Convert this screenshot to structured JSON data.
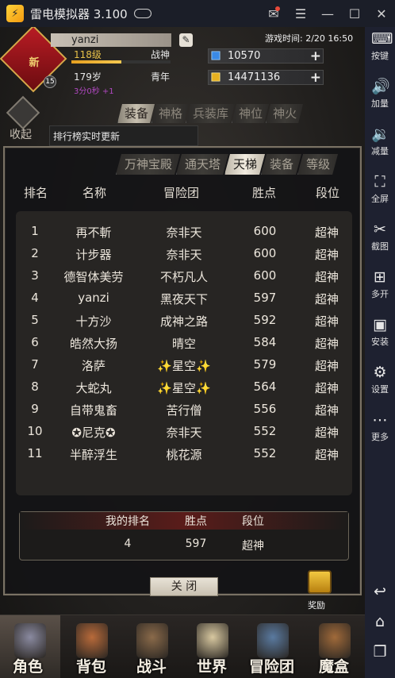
{
  "emulator": {
    "title": "雷电模拟器 3.100",
    "logo_glyph": "⚡",
    "controls": [
      "mail-icon",
      "menu-icon",
      "minimize-icon",
      "maximize-icon",
      "close-icon"
    ]
  },
  "sidebar": {
    "items": [
      {
        "label": "按键",
        "icon": "keyboard-icon",
        "glyph": "⌨"
      },
      {
        "label": "加量",
        "icon": "volume-up-icon",
        "glyph": "🔊"
      },
      {
        "label": "减量",
        "icon": "volume-down-icon",
        "glyph": "🔉"
      },
      {
        "label": "全屏",
        "icon": "fullscreen-icon",
        "glyph": "⛶"
      },
      {
        "label": "截图",
        "icon": "scissors-icon",
        "glyph": "✂"
      },
      {
        "label": "多开",
        "icon": "multi-open-icon",
        "glyph": "⊞"
      },
      {
        "label": "安装",
        "icon": "apk-install-icon",
        "glyph": "▣"
      },
      {
        "label": "设置",
        "icon": "gear-icon",
        "glyph": "⚙"
      },
      {
        "label": "更多",
        "icon": "more-icon",
        "glyph": "⋯"
      }
    ],
    "nav_buttons": [
      {
        "icon": "back-icon",
        "glyph": "↩"
      },
      {
        "icon": "home-icon",
        "glyph": "⌂"
      },
      {
        "icon": "recent-apps-icon",
        "glyph": "❐"
      }
    ]
  },
  "profile": {
    "name": "yanzi",
    "emblem_text": "新",
    "emblem_level": "15",
    "level": "118级",
    "title": "战神",
    "exp_fraction": 0.5,
    "age": "179岁",
    "stage": "青年",
    "timer": "3分0秒 +1",
    "game_time": "游戏时间: 2/20 16:50",
    "gems": "10570",
    "gold": "14471136"
  },
  "main_tabs": {
    "collapse_label": "收起",
    "tabs": [
      "装备",
      "神格",
      "兵装库",
      "神位",
      "神火"
    ],
    "active": "装备",
    "notice": "排行榜实时更新"
  },
  "ranking": {
    "tabs": [
      "万神宝殿",
      "通天塔",
      "天梯",
      "装备",
      "等级"
    ],
    "active_tab": "天梯",
    "headers": [
      "排名",
      "名称",
      "冒险团",
      "胜点",
      "段位"
    ],
    "rows": [
      [
        "1",
        "再不斬",
        "奈非天",
        "600",
        "超神"
      ],
      [
        "2",
        "计步器",
        "奈非天",
        "600",
        "超神"
      ],
      [
        "3",
        "德智体美劳",
        "不朽凡人",
        "600",
        "超神"
      ],
      [
        "4",
        "yanzi",
        "黑夜天下",
        "597",
        "超神"
      ],
      [
        "5",
        "十方沙",
        "成神之路",
        "592",
        "超神"
      ],
      [
        "6",
        "皓然大扬",
        "晴空",
        "584",
        "超神"
      ],
      [
        "7",
        "洛萨",
        "✨星空✨",
        "579",
        "超神"
      ],
      [
        "8",
        "大蛇丸",
        "✨星空✨",
        "564",
        "超神"
      ],
      [
        "9",
        "自带鬼畜",
        "苦行僧",
        "556",
        "超神"
      ],
      [
        "10",
        "✪尼克✪",
        "奈非天",
        "552",
        "超神"
      ],
      [
        "11",
        "半醉浮生",
        "桃花源",
        "552",
        "超神"
      ]
    ],
    "my_rank": {
      "headers": [
        "我的排名",
        "胜点",
        "段位"
      ],
      "values": [
        "4",
        "597",
        "超神"
      ]
    },
    "close_label": "关 闭",
    "reward_label": "奖励"
  },
  "bottom_nav": {
    "items": [
      {
        "label": "角色",
        "icon": "character-helmet-icon",
        "color": "#8a8aa0"
      },
      {
        "label": "背包",
        "icon": "backpack-icon",
        "color": "#b86a3a"
      },
      {
        "label": "战斗",
        "icon": "sword-shield-icon",
        "color": "#8a6a4a"
      },
      {
        "label": "世界",
        "icon": "scroll-map-icon",
        "color": "#d8c8a0"
      },
      {
        "label": "冒险团",
        "icon": "castle-icon",
        "color": "#5a7aa0"
      },
      {
        "label": "魔盒",
        "icon": "magic-box-icon",
        "color": "#a06a3a"
      }
    ],
    "active": "角色"
  }
}
